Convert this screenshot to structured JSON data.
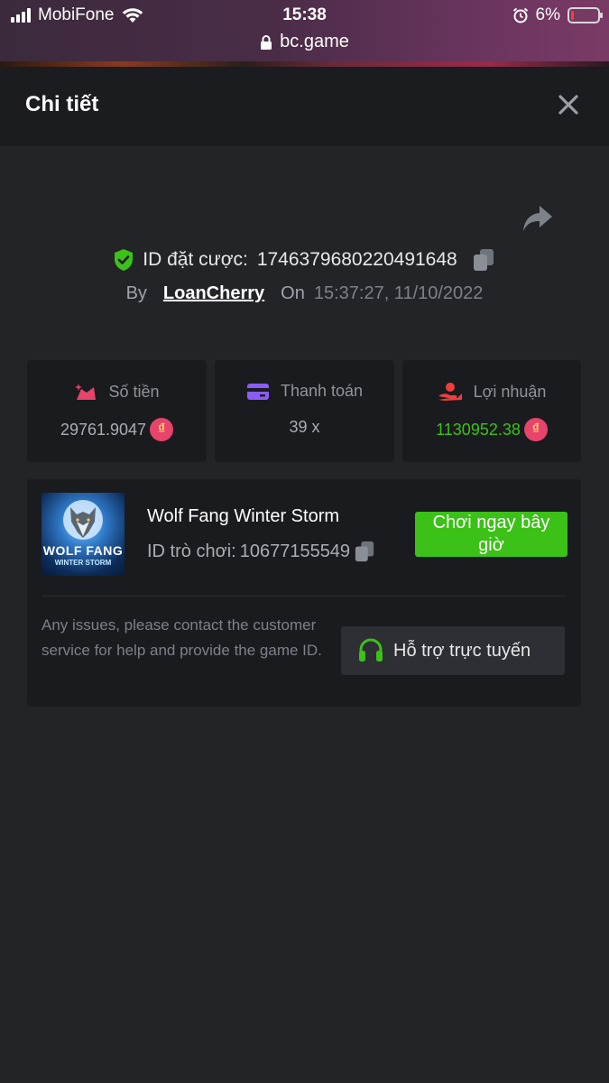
{
  "status_bar": {
    "carrier": "MobiFone",
    "time": "15:38",
    "battery": "6%",
    "url": "bc.game"
  },
  "header": {
    "title": "Chi tiết",
    "close_icon": "close-icon"
  },
  "bet": {
    "id_label": "ID đặt cược:",
    "id_value": "1746379680220491648",
    "by_label": "By",
    "user": "LoanCherry",
    "on_label": "On",
    "datetime": "15:37:27, 11/10/2022"
  },
  "stats": [
    {
      "label": "Số tiền",
      "value": "29761.9047",
      "icon": "amount-icon",
      "color": "#a9adb4"
    },
    {
      "label": "Thanh toán",
      "value": "39 x",
      "icon": "card-icon",
      "color": "#a9adb4"
    },
    {
      "label": "Lợi nhuận",
      "value": "1130952.38",
      "icon": "profit-icon",
      "color": "#3bc117"
    }
  ],
  "currency_symbol": "₫",
  "game": {
    "thumb_title": "WOLF FANG",
    "thumb_subtitle": "WINTER STORM",
    "name": "Wolf Fang Winter Storm",
    "id_label": "ID trò chơi:",
    "id_value": "10677155549",
    "play_label": "Chơi ngay bây giờ"
  },
  "support": {
    "help_text": "Any issues, please contact the customer service for help and provide the game ID.",
    "button_label": "Hỗ trợ trực tuyến"
  },
  "colors": {
    "background": "#232428",
    "panel": "#1a1b1e",
    "accent_green": "#3bc117",
    "coin": "#e6446a"
  }
}
